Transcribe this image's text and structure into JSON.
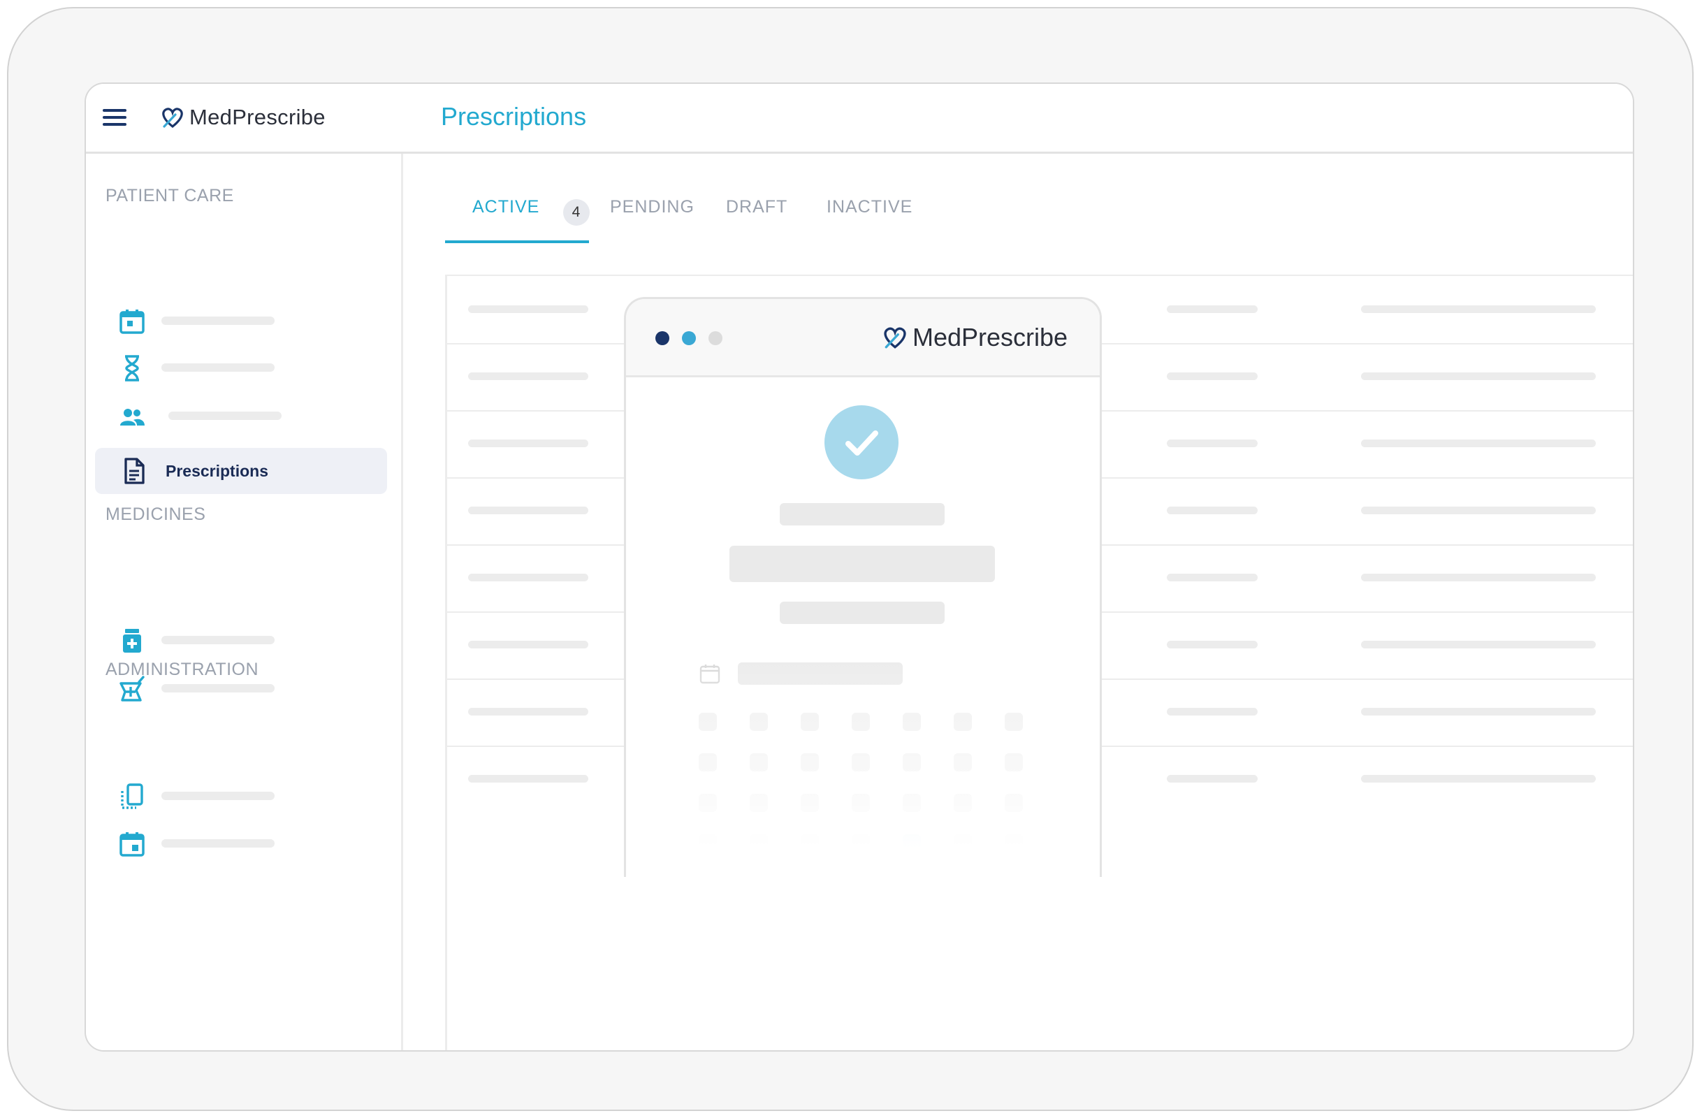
{
  "app": {
    "name": "MedPrescribe",
    "page_title": "Prescriptions"
  },
  "colors": {
    "accent": "#23a9cf",
    "navy": "#1a3569",
    "muted": "#9aa1ad"
  },
  "sidebar": {
    "sections": [
      {
        "label": "PATIENT CARE",
        "items": [
          {
            "icon": "calendar-icon"
          },
          {
            "icon": "hourglass-icon"
          },
          {
            "icon": "people-icon"
          },
          {
            "icon": "document-icon",
            "label": "Prescriptions",
            "active": true
          }
        ]
      },
      {
        "label": "MEDICINES",
        "items": [
          {
            "icon": "medicine-bottle-icon"
          },
          {
            "icon": "mortar-pestle-icon"
          }
        ]
      },
      {
        "label": "ADMINISTRATION",
        "items": [
          {
            "icon": "device-icon"
          },
          {
            "icon": "calendar-event-icon"
          }
        ]
      }
    ]
  },
  "tabs": [
    {
      "label": "ACTIVE",
      "count": "4",
      "active": true
    },
    {
      "label": "PENDING"
    },
    {
      "label": "DRAFT"
    },
    {
      "label": "INACTIVE"
    }
  ],
  "modal": {
    "brand": "MedPrescribe",
    "window_dots": [
      "#1a3569",
      "#3aa8d4",
      "#dcdcdc"
    ],
    "status": "success-check-icon"
  }
}
